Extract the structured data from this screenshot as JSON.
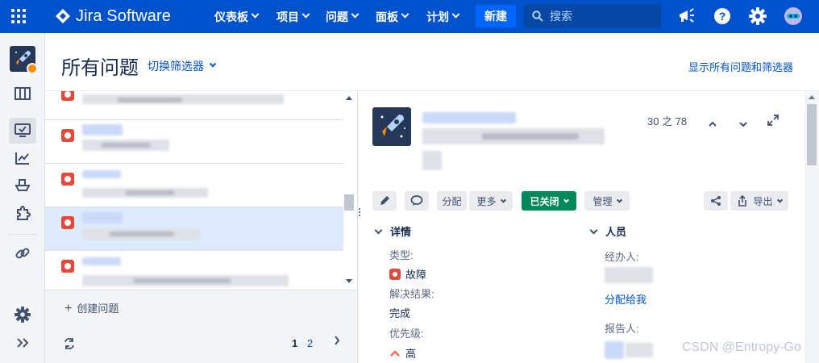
{
  "topnav": {
    "brand": "Jira Software",
    "menu": [
      "仪表板",
      "项目",
      "问题",
      "面板",
      "计划"
    ],
    "create": "新建",
    "search_placeholder": "搜索"
  },
  "header": {
    "title": "所有问题",
    "filter_switch": "切换筛选器",
    "show_all": "显示所有问题和筛选器"
  },
  "list_footer": {
    "create_issue": "创建问题",
    "pages": [
      "1",
      "2"
    ]
  },
  "detail": {
    "counter": "30 之 78",
    "toolbar": {
      "assign": "分配",
      "more": "更多",
      "status": "已关闭",
      "admin": "管理",
      "export": "导出"
    },
    "details_section": {
      "title": "详情",
      "type_label": "类型:",
      "type_value": "故障",
      "resolution_label": "解决结果:",
      "resolution_value": "完成",
      "priority_label": "优先级:",
      "priority_value": "高"
    },
    "people_section": {
      "title": "人员",
      "assignee_label": "经办人:",
      "assign_to_me": "分配给我",
      "reporter_label": "报告人:"
    }
  },
  "watermark": "CSDN @Entropy-Go",
  "colors": {
    "nav_bg": "#0052cc",
    "create_btn": "#0065ff",
    "status_closed": "#00875a",
    "bug": "#e5493a",
    "selected_row": "#deebff",
    "link": "#0052cc"
  }
}
